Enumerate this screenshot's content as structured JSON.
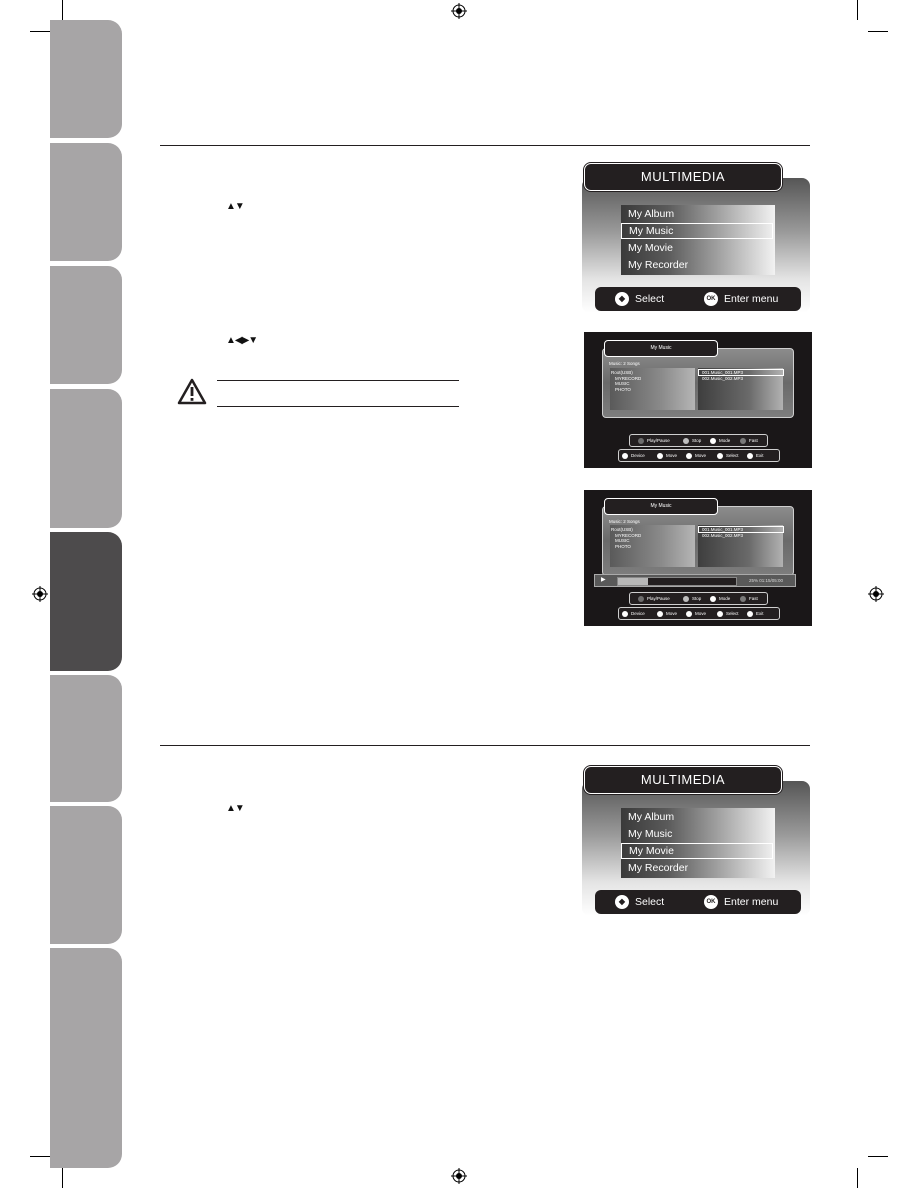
{
  "page": {
    "side_tabs": [
      {
        "label": "",
        "active": false
      },
      {
        "label": "",
        "active": false
      },
      {
        "label": "",
        "active": false
      },
      {
        "label": "",
        "active": false
      },
      {
        "label": "",
        "active": true
      },
      {
        "label": "",
        "active": false
      },
      {
        "label": "",
        "active": false
      },
      {
        "label": "",
        "active": false
      }
    ],
    "section1": {
      "nav_arrows_1": "▲▼",
      "nav_arrows_2": "▲◀▶▼"
    },
    "section2": {
      "nav_arrows_1": "▲▼"
    },
    "warning": {
      "icon": "warning-triangle-icon",
      "text": ""
    }
  },
  "multimedia_menu_1": {
    "title": "MULTIMEDIA",
    "items": [
      "My Album",
      "My Music",
      "My Movie",
      "My Recorder"
    ],
    "selected_index": 1,
    "footer": {
      "select_icon": "◆",
      "select_label": "Select",
      "ok_icon": "OK",
      "enter_label": "Enter menu"
    }
  },
  "music_browser_1": {
    "title": "My Music",
    "count": "Music: 2 Songs",
    "folders": [
      "Root(USB)",
      "MYRECORD",
      "MUSIC",
      "PHOTO"
    ],
    "files": [
      "001.Music_001.MP3",
      "002.Music_002.MP3"
    ],
    "selected_file_index": 0,
    "controls": [
      {
        "label": "Play/Pause",
        "color": "#6d6d6d"
      },
      {
        "label": "Stop",
        "color": "#bdbdbd"
      },
      {
        "label": "Mode",
        "color": "#ffffff"
      },
      {
        "label": "Fast",
        "color": "#7a7a7a"
      }
    ],
    "nav": [
      {
        "key": "USB",
        "label": "Device"
      },
      {
        "key": "◀▶",
        "label": "Move"
      },
      {
        "key": "▲▼",
        "label": "Move"
      },
      {
        "key": "OK",
        "label": "Select"
      },
      {
        "key": "EXIT",
        "label": "Exit"
      }
    ]
  },
  "music_browser_2": {
    "title": "My Music",
    "count": "Music: 2 Songs",
    "folders": [
      "Root(USB)",
      "MYRECORD",
      "MUSIC",
      "PHOTO"
    ],
    "files": [
      "001.Music_001.MP3",
      "002.Music_002.MP3"
    ],
    "selected_file_index": 0,
    "playback": {
      "state_icon": "▶",
      "progress_percent": 25,
      "time": "25% 01:15/05:00"
    },
    "controls": [
      {
        "label": "Play/Pause",
        "color": "#6d6d6d"
      },
      {
        "label": "Stop",
        "color": "#bdbdbd"
      },
      {
        "label": "Mode",
        "color": "#ffffff"
      },
      {
        "label": "Fast",
        "color": "#7a7a7a"
      }
    ],
    "nav": [
      {
        "key": "USB",
        "label": "Device"
      },
      {
        "key": "◀▶",
        "label": "Move"
      },
      {
        "key": "▲▼",
        "label": "Move"
      },
      {
        "key": "OK",
        "label": "Select"
      },
      {
        "key": "EXIT",
        "label": "Exit"
      }
    ]
  },
  "multimedia_menu_2": {
    "title": "MULTIMEDIA",
    "items": [
      "My Album",
      "My Music",
      "My Movie",
      "My Recorder"
    ],
    "selected_index": 2,
    "footer": {
      "select_icon": "◆",
      "select_label": "Select",
      "ok_icon": "OK",
      "enter_label": "Enter menu"
    }
  }
}
